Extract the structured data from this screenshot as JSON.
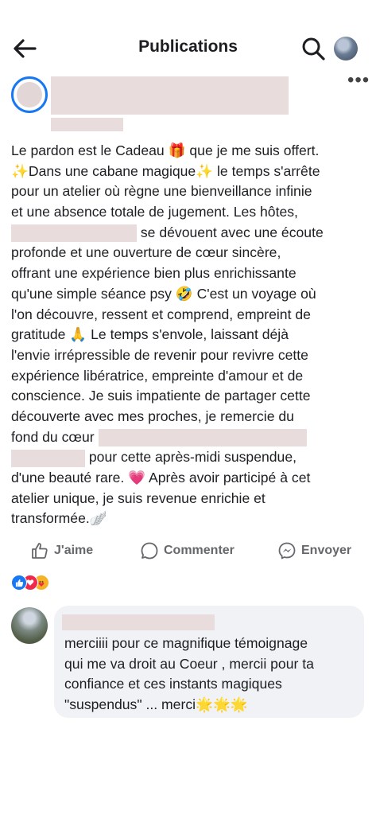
{
  "header": {
    "title": "Publications",
    "back_icon": "arrow-left-icon",
    "search_icon": "search-icon"
  },
  "post": {
    "menu_label": "•••",
    "lines": [
      "Le pardon est le Cadeau 🎁 que je me suis offert.",
      "✨Dans une cabane magique✨ le temps s'arrête",
      "pour un atelier où règne une bienveillance infinie",
      "et une absence totale de jugement. Les hôtes,",
      " se dévouent avec une écoute",
      "profonde et une ouverture de cœur sincère,",
      "offrant une expérience bien plus enrichissante",
      "qu'une simple séance psy 🤣 C'est un voyage où",
      "l'on découvre, ressent et comprend, empreint de",
      "gratitude 🙏 Le temps s'envole, laissant déjà",
      "l'envie irrépressible de revenir pour revivre cette",
      "expérience libératrice, empreinte d'amour et de",
      "conscience. Je suis impatiente de partager cette",
      "découverte avec mes proches, je remercie du",
      "fond du cœur ",
      " pour cette après-midi suspendue,",
      "d'une beauté rare. 💗 Après avoir participé à cet",
      "atelier unique, je suis revenue enrichie et",
      "transformée.🪽"
    ]
  },
  "actions": {
    "like": "J'aime",
    "comment": "Commenter",
    "send": "Envoyer"
  },
  "reactions": [
    "like",
    "love",
    "care"
  ],
  "comment": {
    "lines": [
      "merciiii pour ce magnifique témoignage",
      "qui me va droit au Coeur , mercii pour ta",
      "confiance et ces instants magiques",
      "\"suspendus\" ... merci🌟🌟🌟"
    ]
  },
  "colors": {
    "accent": "#1877f2",
    "text": "#1c1e21",
    "secondary": "#65676b",
    "bubble": "#f0f2f5",
    "redaction": "#e8dcdc"
  }
}
